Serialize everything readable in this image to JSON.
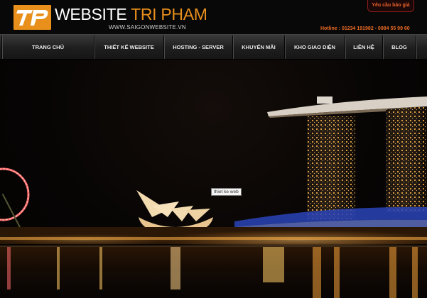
{
  "brand": {
    "name_part1": "WEBSITE",
    "name_part2": "TRI PHAM",
    "domain": "WWW.SAIGONWEBSITE.VN",
    "logo_text": "TP",
    "accent_color": "#e98f1b"
  },
  "header": {
    "quote_button": "Yêu cầu báo giá",
    "hotline": "Hotline : 01234 191982 - 0984 55 99 60"
  },
  "nav": {
    "items": [
      {
        "label": "TRANG CHỦ"
      },
      {
        "label": "THIẾT KẾ WEBSITE"
      },
      {
        "label": "HOSTING - SERVER"
      },
      {
        "label": "KHUYẾN MÃI"
      },
      {
        "label": "KHO GIAO DIỆN"
      },
      {
        "label": "LIÊN HỆ"
      },
      {
        "label": "BLOG"
      }
    ]
  },
  "hero": {
    "tooltip": "thiet ke web"
  }
}
